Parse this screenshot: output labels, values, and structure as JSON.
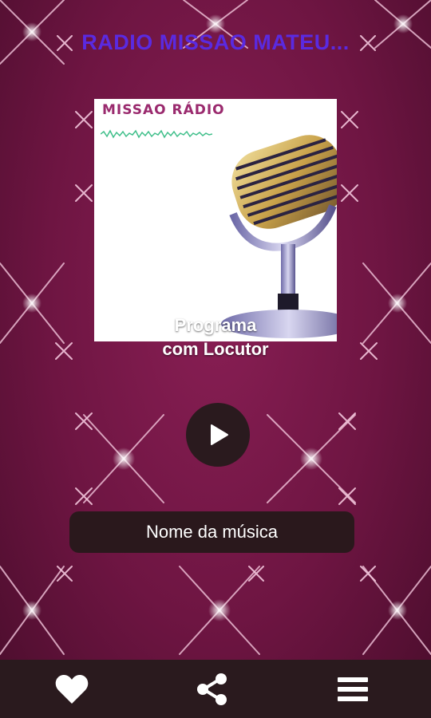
{
  "header": {
    "title": "RADIO MISSAO MATEU..."
  },
  "cover": {
    "brand": "MISSAO RÁDIO",
    "program_line1": "Programa",
    "program_line2": "com Locutor"
  },
  "player": {
    "play_icon": "play-icon",
    "song_title": "Nome da música"
  },
  "bottom_nav": {
    "items": [
      {
        "icon": "heart-icon"
      },
      {
        "icon": "share-icon"
      },
      {
        "icon": "menu-icon"
      }
    ]
  },
  "colors": {
    "background": "#7a1a4b",
    "title": "#5a2ae0",
    "bars": "#2a1a1e",
    "text": "#ffffff"
  }
}
